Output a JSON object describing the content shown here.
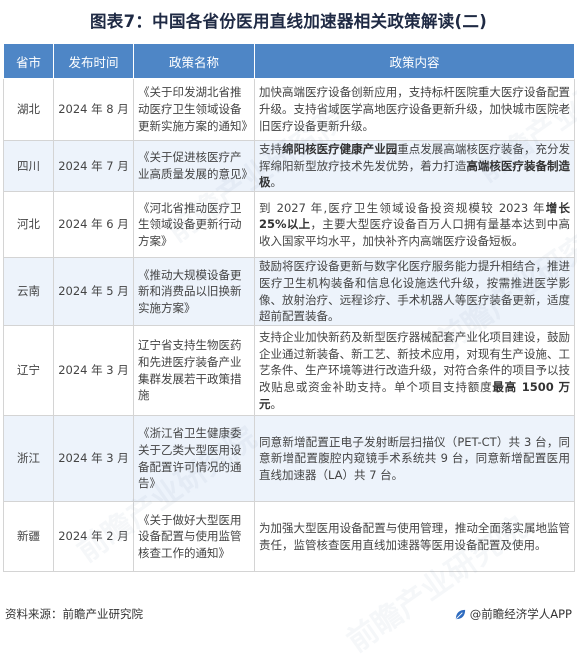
{
  "title": "图表7：中国各省份医用直线加速器相关政策解读(二)",
  "table": {
    "headers": [
      "省市",
      "发布时间",
      "政策名称",
      "政策内容"
    ],
    "rows": [
      {
        "province": "湖北",
        "date": "2024 年 8 月",
        "name": "《关于印发湖北省推动医疗卫生领域设备更新实施方案的通知》",
        "content": [
          {
            "t": "加快高端医疗设备创新应用，支持标杆医院重大医疗设备配置升级。支持省域医学高地医疗设备更新升级，加快城市医院老旧医疗设备更新升级。"
          }
        ]
      },
      {
        "province": "四川",
        "date": "2024 年 7 月",
        "name": "《关于促进核医疗产业高质量发展的意见》",
        "content": [
          {
            "t": "支持"
          },
          {
            "t": "绵阳核医疗健康产业园",
            "b": true
          },
          {
            "t": "重点发展高端核医疗装备，充分发挥绵阳新型放疗技术先发优势，着力打造"
          },
          {
            "t": "高端核医疗装备制造极",
            "b": true
          },
          {
            "t": "。"
          }
        ]
      },
      {
        "province": "河北",
        "date": "2024 年 6 月",
        "name": "《河北省推动医疗卫生领域设备更新行动方案》",
        "content": [
          {
            "t": "到 2027 年,医疗卫生领域设备投资规模较 2023 年"
          },
          {
            "t": "增长 25%以上",
            "b": true
          },
          {
            "t": "，主要大型医疗设备百万人口拥有量基本达到中高收入国家平均水平，加快补齐内高端医疗设备短板。"
          }
        ]
      },
      {
        "province": "云南",
        "date": "2024 年 5 月",
        "name": "《推动大规模设备更新和消费品以旧换新实施方案》",
        "content": [
          {
            "t": "鼓励将医疗设备更新与数字化医疗服务能力提升相结合，推进医疗卫生机构装备和信息化设施迭代升级，按需推进医学影像、放射治疗、远程诊疗、手术机器人等医疗装备更新，适度超前配置装备。"
          }
        ]
      },
      {
        "province": "辽宁",
        "date": "2024 年 3 月",
        "name": "辽宁省支持生物医药和先进医疗装备产业集群发展若干政策措施",
        "content": [
          {
            "t": "支持企业加快新药及新型医疗器械配套产业化项目建设，鼓励企业通过新装备、新工艺、新技术应用，对现有生产设施、工艺条件、生产环境等进行改造升级，对符合条件的项目予以技改贴息或资金补助支持。单个项目支持额度"
          },
          {
            "t": "最高 1500 万元",
            "b": true
          },
          {
            "t": "。"
          }
        ]
      },
      {
        "province": "浙江",
        "date": "2024 年 3 月",
        "name": "《浙江省卫生健康委关于乙类大型医用设备配置许可情况的通告》",
        "content": [
          {
            "t": "同意新增配置正电子发射断层扫描仪（PET-CT）共 3 台，同意新增配置腹腔内窥镜手术系统共 9 台，同意新增配置医用直线加速器（LA）共 7 台。"
          }
        ]
      },
      {
        "province": "新疆",
        "date": "2024 年 2 月",
        "name": "《关于做好大型医用设备配置与使用监管核查工作的通知》",
        "content": [
          {
            "t": "为加强大型医用设备配置与使用管理，推动全面落实属地监管责任，监管核查医用直线加速器等医用设备配置及使用。"
          }
        ]
      }
    ]
  },
  "footer": {
    "source": "资料来源：前瞻产业研究院",
    "brand": "@前瞻经济学人APP",
    "brand_icon": "leaf-icon"
  },
  "watermark": "前瞻产业研究院",
  "colors": {
    "header_bg": "#4e86c6",
    "stripe_bg": "#edf3fb",
    "title": "#1f2a44",
    "brand_icon": "#2f6cbf"
  }
}
